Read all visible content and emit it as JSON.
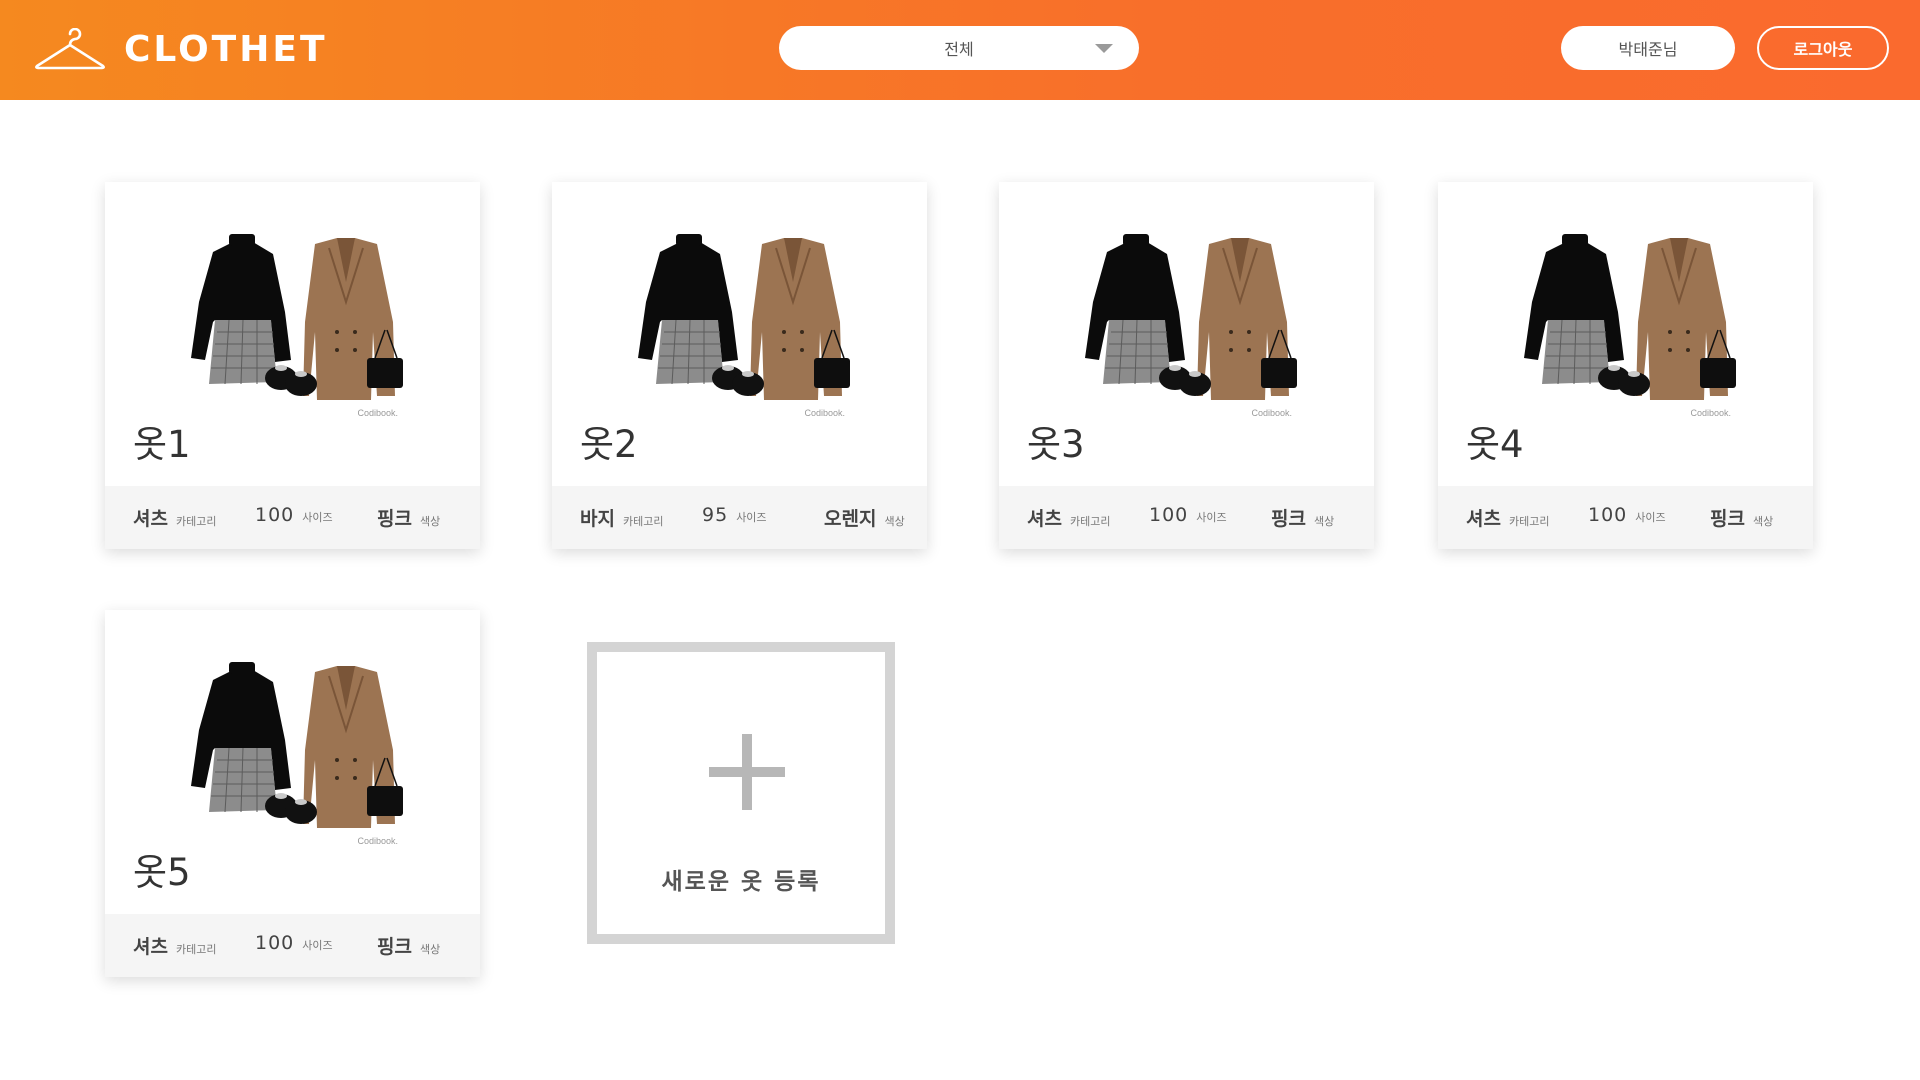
{
  "header": {
    "logo_text": "CLOTHET",
    "category_select": {
      "selected": "전체"
    },
    "user_button": "박태준님",
    "logout_button": "로그아웃"
  },
  "colors": {
    "header_start": "#F5891F",
    "header_end": "#FA6A2E",
    "card_footer": "#f5f5f5",
    "add_border": "#d4d4d4"
  },
  "clothes": [
    {
      "name": "옷1",
      "watermark": "Codibook.",
      "category": "셔츠",
      "category_label": "카테고리",
      "size": "100",
      "size_label": "사이즈",
      "color": "핑크",
      "color_label": "색상"
    },
    {
      "name": "옷2",
      "watermark": "Codibook.",
      "category": "바지",
      "category_label": "카테고리",
      "size": "95",
      "size_label": "사이즈",
      "color": "오렌지",
      "color_label": "색상"
    },
    {
      "name": "옷3",
      "watermark": "Codibook.",
      "category": "셔츠",
      "category_label": "카테고리",
      "size": "100",
      "size_label": "사이즈",
      "color": "핑크",
      "color_label": "색상"
    },
    {
      "name": "옷4",
      "watermark": "Codibook.",
      "category": "셔츠",
      "category_label": "카테고리",
      "size": "100",
      "size_label": "사이즈",
      "color": "핑크",
      "color_label": "색상"
    },
    {
      "name": "옷5",
      "watermark": "Codibook.",
      "category": "셔츠",
      "category_label": "카테고리",
      "size": "100",
      "size_label": "사이즈",
      "color": "핑크",
      "color_label": "색상"
    }
  ],
  "add_card": {
    "label": "새로운 옷 등록",
    "icon": "plus-icon"
  }
}
